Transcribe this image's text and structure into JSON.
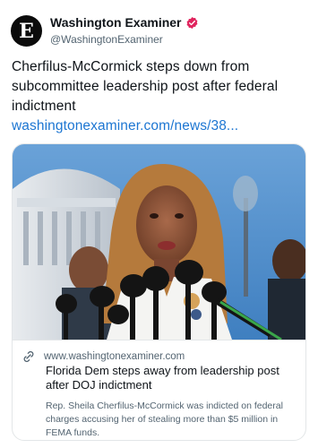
{
  "account": {
    "name": "Washington Examiner",
    "handle": "@WashingtonExaminer",
    "avatar_glyph": "E",
    "verified_color": "#e0245e"
  },
  "post": {
    "text": "Cherfilus-McCormick steps down from subcommittee leadership post after federal indictment ",
    "link": "washingtonexaminer.com/news/38..."
  },
  "card": {
    "domain": "www.washingtonexaminer.com",
    "title": "Florida Dem steps away from leadership post after DOJ indictment",
    "description": "Rep. Sheila Cherfilus-McCormick was indicted on federal charges accusing her of stealing more than $5 million in FEMA funds.",
    "link_icon": "link-icon",
    "image_desc_icon": "news-photo"
  },
  "colors": {
    "link": "#1d76d2",
    "secondary_text": "#536471",
    "border": "#e3e6e8"
  }
}
